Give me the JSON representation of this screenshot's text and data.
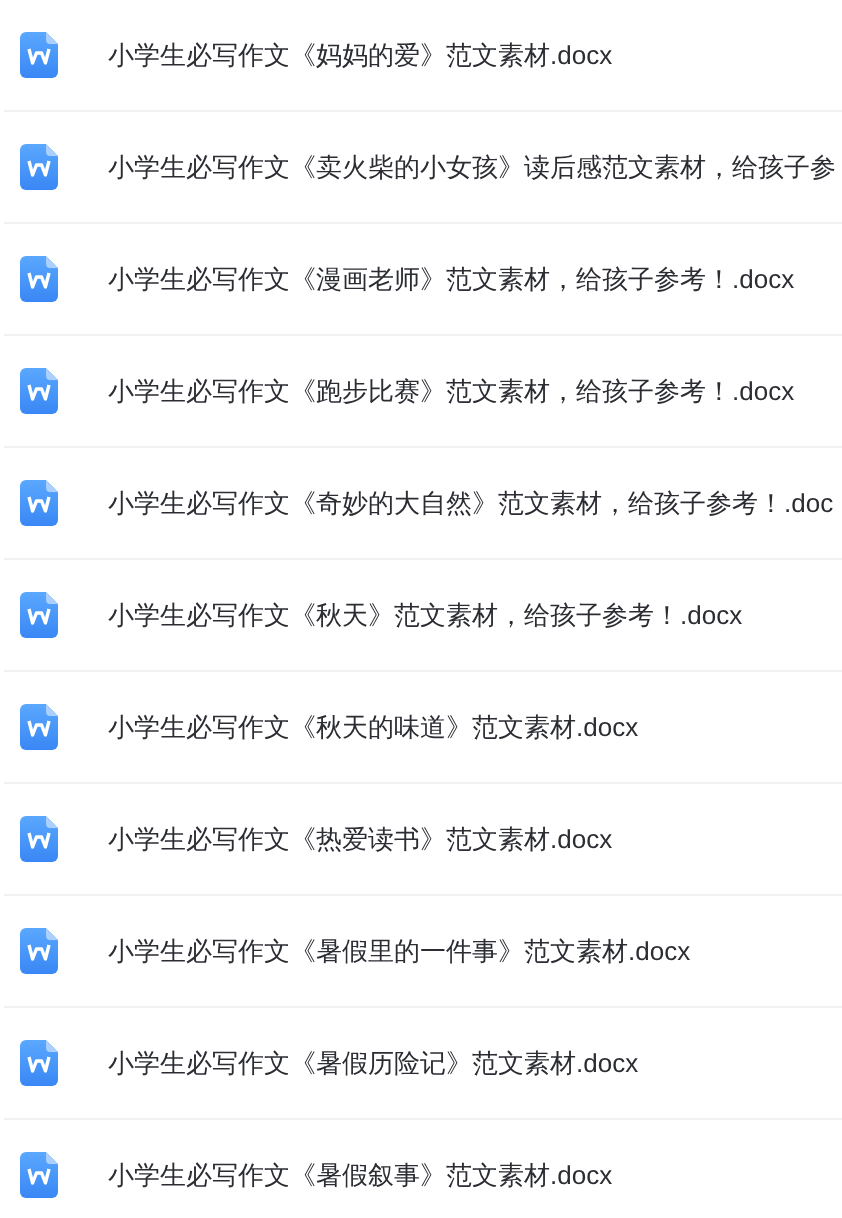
{
  "files": [
    {
      "name": "小学生必写作文《妈妈的爱》范文素材.docx"
    },
    {
      "name": "小学生必写作文《卖火柴的小女孩》读后感范文素材，给孩子参"
    },
    {
      "name": "小学生必写作文《漫画老师》范文素材，给孩子参考！.docx"
    },
    {
      "name": "小学生必写作文《跑步比赛》范文素材，给孩子参考！.docx"
    },
    {
      "name": "小学生必写作文《奇妙的大自然》范文素材，给孩子参考！.doc"
    },
    {
      "name": "小学生必写作文《秋天》范文素材，给孩子参考！.docx"
    },
    {
      "name": "小学生必写作文《秋天的味道》范文素材.docx"
    },
    {
      "name": "小学生必写作文《热爱读书》范文素材.docx"
    },
    {
      "name": "小学生必写作文《暑假里的一件事》范文素材.docx"
    },
    {
      "name": "小学生必写作文《暑假历险记》范文素材.docx"
    },
    {
      "name": "小学生必写作文《暑假叙事》范文素材.docx"
    }
  ]
}
